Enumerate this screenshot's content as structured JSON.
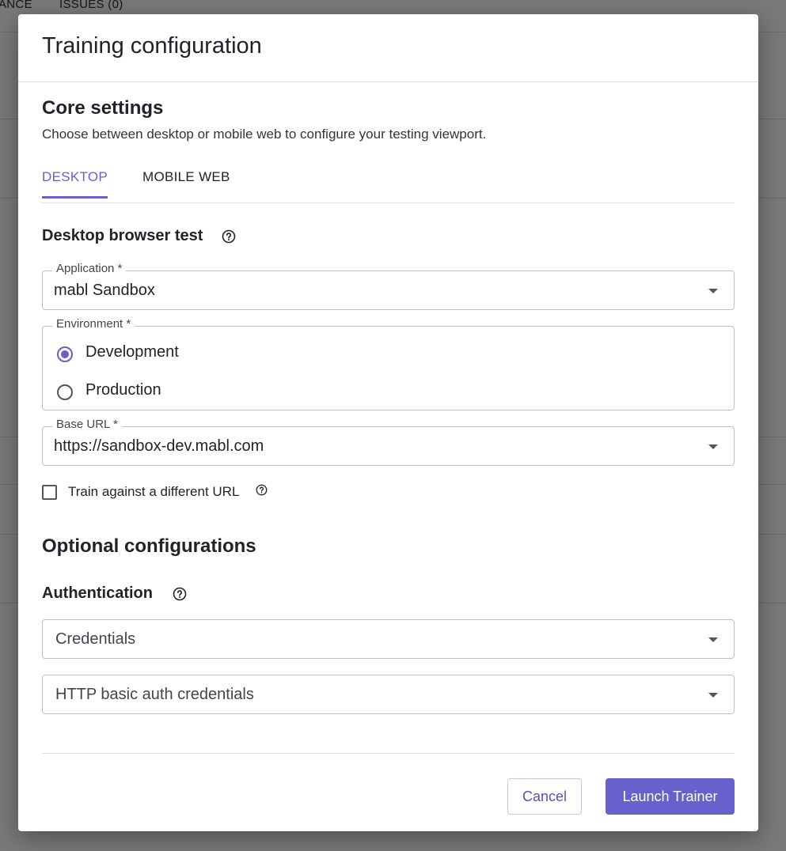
{
  "background": {
    "tabs": [
      "ANCE",
      "ISSUES (0)"
    ]
  },
  "modal": {
    "title": "Training configuration",
    "core": {
      "title": "Core settings",
      "subtitle": "Choose between desktop or mobile web to configure your testing viewport.",
      "tabs": [
        {
          "label": "DESKTOP",
          "active": true
        },
        {
          "label": "MOBILE WEB",
          "active": false
        }
      ],
      "desktop_heading": "Desktop browser test",
      "application": {
        "label": "Application *",
        "value": "mabl Sandbox"
      },
      "environment": {
        "label": "Environment *",
        "options": [
          {
            "label": "Development",
            "selected": true
          },
          {
            "label": "Production",
            "selected": false
          }
        ]
      },
      "base_url": {
        "label": "Base URL *",
        "value": "https://sandbox-dev.mabl.com"
      },
      "different_url": {
        "label": "Train against a different URL",
        "checked": false
      }
    },
    "optional": {
      "title": "Optional configurations",
      "auth_heading": "Authentication",
      "credentials_placeholder": "Credentials",
      "http_auth_placeholder": "HTTP basic auth credentials"
    },
    "footer": {
      "cancel_label": "Cancel",
      "launch_label": "Launch Trainer"
    }
  },
  "colors": {
    "accent": "#6661cc",
    "overlay": "rgba(0,0,0,0.5)"
  },
  "icons": {
    "help": "help-circle-icon",
    "dropdown": "caret-down-icon"
  }
}
